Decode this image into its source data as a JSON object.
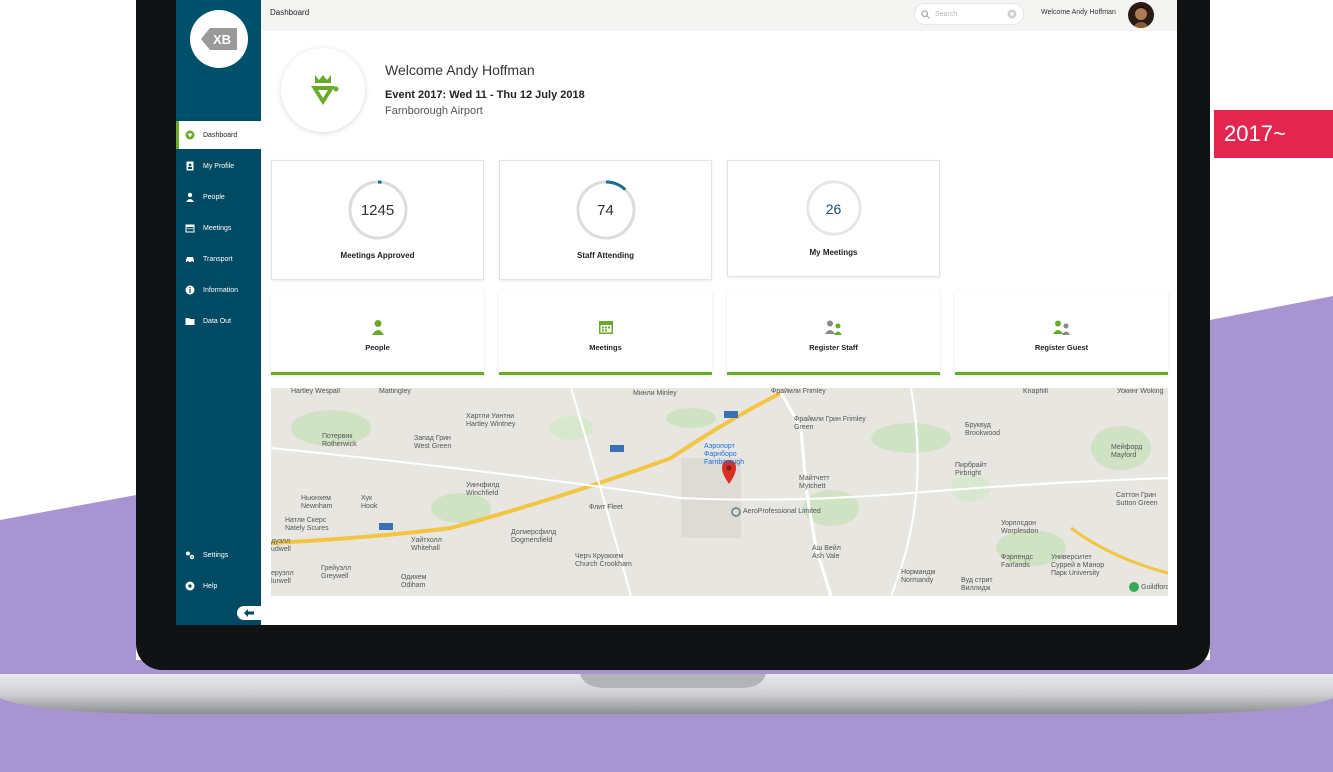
{
  "corner_tag": "2017~",
  "app": {
    "logo_text": "XB"
  },
  "topbar": {
    "breadcrumb": "Dashboard",
    "search_placeholder": "Search",
    "welcome": "Welcome Andy Hoffman"
  },
  "sidebar": {
    "items": [
      {
        "label": "Dashboard",
        "icon": "compass-icon",
        "active": true
      },
      {
        "label": "My Profile",
        "icon": "id-badge-icon"
      },
      {
        "label": "People",
        "icon": "user-icon"
      },
      {
        "label": "Meetings",
        "icon": "calendar-icon"
      },
      {
        "label": "Transport",
        "icon": "car-icon"
      },
      {
        "label": "Information",
        "icon": "info-icon"
      },
      {
        "label": "Data Out",
        "icon": "folder-icon"
      }
    ],
    "bottom": [
      {
        "label": "Settings",
        "icon": "settings-icon"
      },
      {
        "label": "Help",
        "icon": "help-icon"
      }
    ]
  },
  "welcome": {
    "greeting": "Welcome Andy Hoffman",
    "event": "Event 2017: Wed 11 - Thu 12 July 2018",
    "venue": "Farnborough Airport"
  },
  "stats": [
    {
      "value": "1245",
      "label": "Meetings Approved",
      "progress": 0.02
    },
    {
      "value": "74",
      "label": "Staff Attending",
      "progress": 0.12
    },
    {
      "value": "26",
      "label": "My Meetings",
      "progress": 0
    }
  ],
  "quick_links": [
    {
      "label": "People",
      "icon": "user-icon"
    },
    {
      "label": "Meetings",
      "icon": "calendar-icon"
    },
    {
      "label": "Register Staff",
      "icon": "users-icon"
    },
    {
      "label": "Register Guest",
      "icon": "users-icon"
    }
  ],
  "map": {
    "labels": [
      "Hartley Wespall",
      "Mattingley",
      "Минли Minley",
      "Фраймли Frimley",
      "Knaphill",
      "Уокинг Woking",
      "Хартли Уинтни Hartley Wintney",
      "Фраймли Грин Frimley Green",
      "Бруквуд Brookwood",
      "Потервик Rotherwick",
      "Запад Грин West Green",
      "Аэропорт Фарнборо Farnborough",
      "Майтчетт Mytchett",
      "Пирбрайт Pirbright",
      "Мейфорд Mayford",
      "Ньюнхем Newnham",
      "Хук Hook",
      "Уинчфилд Winchfield",
      "Флит Fleet",
      "AeroProfessional Limited",
      "Саттон Грин Sutton Green",
      "Натли Скерс Nately Scures",
      "Уайтхолл Whitehall",
      "Догмерсфилд Dogmersfield",
      "Уорплсдон Worplesdon",
      "Аш Вейл Ash Vale",
      "Фэрлендс Fairlands",
      "Университет Суррей в Манор Парк University",
      "Черч Круокхем Church Crookham",
      "Грейуэлл Greywell",
      "Одихем Odiham",
      "Нормандм Normandy",
      "Вуд стрит Виллидж",
      "Guildford",
      "дуэлл udwell",
      "еруэлл lurwell"
    ]
  }
}
